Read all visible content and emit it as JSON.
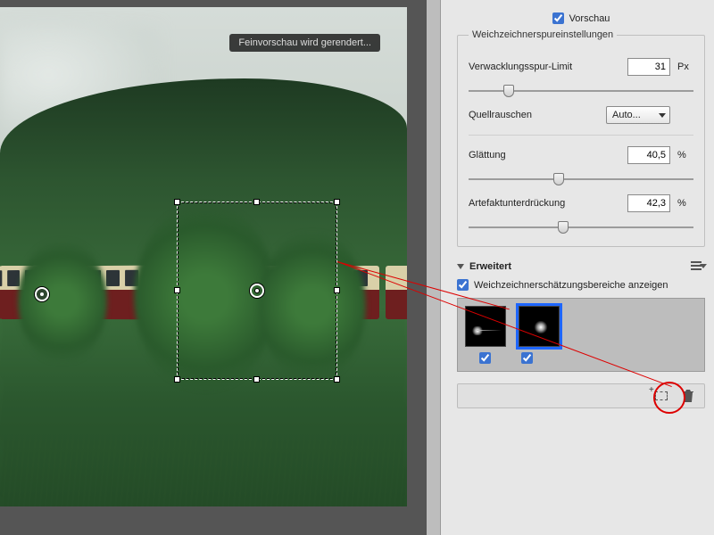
{
  "preview": {
    "label": "Vorschau",
    "checked": true
  },
  "status": {
    "rendering": "Feinvorschau wird gerendert..."
  },
  "blur_trace": {
    "legend": "Weichzeichnerspureinstellungen",
    "limit_label": "Verwacklungsspur-Limit",
    "limit_value": "31",
    "limit_unit": "Px",
    "limit_pct": 18,
    "noise_label": "Quellrauschen",
    "noise_value": "Auto...",
    "smoothing_label": "Glättung",
    "smoothing_value": "40,5",
    "smoothing_unit": "%",
    "smoothing_pct": 40,
    "artifact_label": "Artefaktunterdrückung",
    "artifact_value": "42,3",
    "artifact_unit": "%",
    "artifact_pct": 42
  },
  "advanced": {
    "title": "Erweitert",
    "show_regions_label": "Weichzeichnerschätzungsbereiche anzeigen",
    "show_regions_checked": true,
    "thumbs": [
      {
        "checked": true,
        "selected": false
      },
      {
        "checked": true,
        "selected": true
      }
    ]
  }
}
